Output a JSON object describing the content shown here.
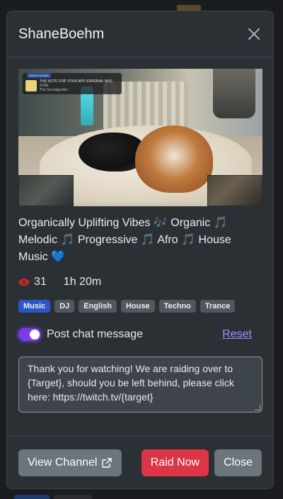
{
  "modal": {
    "title": "ShaneBoehm",
    "close_icon": "close-icon"
  },
  "stream": {
    "title": "Organically Uplifting Vibes 🎶 Organic 🎵 Melodic 🎵 Progressive 🎵 Afro 🎵 House Music 💙",
    "viewers": "31",
    "uptime": "1h 20m",
    "tags": [
      "Music",
      "DJ",
      "English",
      "House",
      "Techno",
      "Trance"
    ],
    "now_playing": {
      "badge": "NOW PLAYING",
      "track": "THE NOTE FOR YOUR APP (ORIGINAL MIX)",
      "artist": "STAE",
      "label": "The Soundgarden"
    }
  },
  "chat": {
    "toggle_label": "Post chat message",
    "toggle_on": true,
    "reset_label": "Reset",
    "message": "Thank you for watching! We are raiding over to {Target}, should you be left behind, please click here: https://twitch.tv/{target}"
  },
  "footer": {
    "view_channel_label": "View Channel",
    "raid_now_label": "Raid Now",
    "close_label": "Close"
  },
  "colors": {
    "modal_bg": "#2b3035",
    "primary_tag": "#2c56c4",
    "toggle": "#7c3aed",
    "danger": "#dc3545",
    "secondary": "#6c757d",
    "viewer_icon": "#e0241e"
  }
}
